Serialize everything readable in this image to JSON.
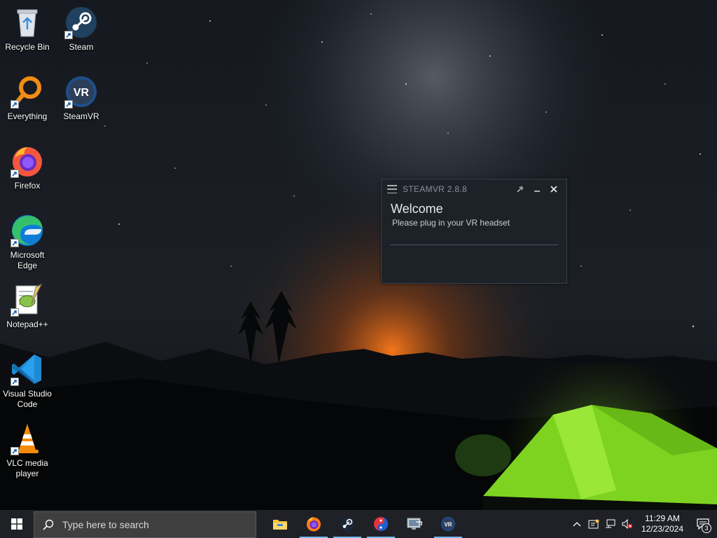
{
  "desktop": {
    "icons": [
      {
        "label": "Recycle Bin",
        "icon": "recycle-bin-icon"
      },
      {
        "label": "Steam",
        "icon": "steam-icon"
      },
      {
        "label": "Everything",
        "icon": "everything-search-icon"
      },
      {
        "label": "SteamVR",
        "icon": "steamvr-icon"
      },
      {
        "label": "Firefox",
        "icon": "firefox-icon"
      },
      {
        "label": "Microsoft Edge",
        "icon": "edge-icon"
      },
      {
        "label": "Notepad++",
        "icon": "notepadpp-icon"
      },
      {
        "label": "Visual Studio Code",
        "icon": "vscode-icon"
      },
      {
        "label": "VLC media player",
        "icon": "vlc-icon"
      }
    ]
  },
  "steamvr_window": {
    "title": "STEAMVR 2.8.8",
    "heading": "Welcome",
    "message": "Please plug in your VR headset"
  },
  "taskbar": {
    "search_placeholder": "Type here to search",
    "apps": [
      "file-explorer-icon",
      "firefox-icon",
      "steam-icon",
      "app-icon",
      "remote-desktop-icon",
      "steamvr-icon"
    ],
    "time": "11:29 AM",
    "date": "12/23/2024",
    "notification_count": "3"
  },
  "colors": {
    "taskbar_bg": "#1f2127",
    "window_bg": "#1d2229",
    "tent": "#7ed321",
    "horizon_glow": "#e06a1a"
  }
}
